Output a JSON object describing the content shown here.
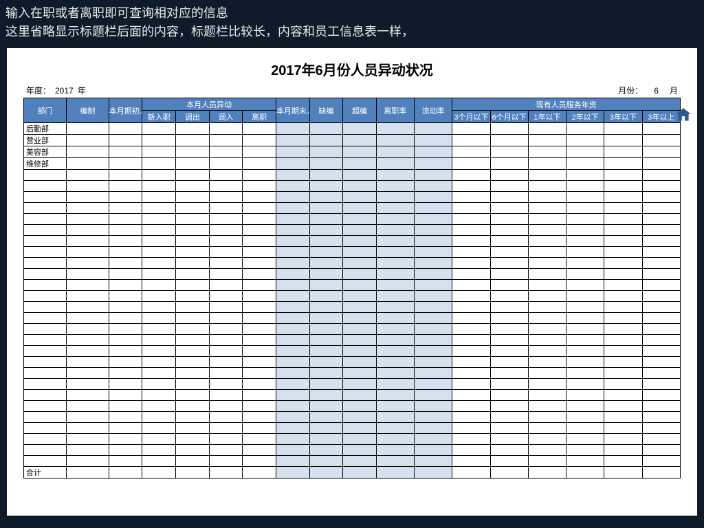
{
  "intro": {
    "line1": "输入在职或者离职即可查询相对应的信息",
    "line2": "这里省略显示标题栏后面的内容，标题栏比较长，内容和员工信息表一样，"
  },
  "sheet": {
    "title": "2017年6月份人员异动状况",
    "year_label": "年度：",
    "year_value": "2017",
    "year_suffix": "年",
    "month_label": "月份：",
    "month_value": "6",
    "month_suffix": "月"
  },
  "headers": {
    "dept": "部门",
    "bianzhi": "编制",
    "init": "本月期初人数",
    "movement_group": "本月人员异动",
    "mv_new": "新入职",
    "mv_out": "调出",
    "mv_in": "调入",
    "mv_leave": "离职",
    "end": "本月期末人数",
    "gap": "缺编",
    "over": "超编",
    "leave_rate": "离职率",
    "flow_rate": "流动率",
    "service_group": "现有人员服务年资",
    "s1": "3个月以下",
    "s2": "6个月以下",
    "s3": "1年以下",
    "s4": "2年以下",
    "s5": "3年以下",
    "s6": "3年以上"
  },
  "departments": [
    "后勤部",
    "营业部",
    "美容部",
    "维修部"
  ],
  "total_label": "合计",
  "empty_rows": 27
}
